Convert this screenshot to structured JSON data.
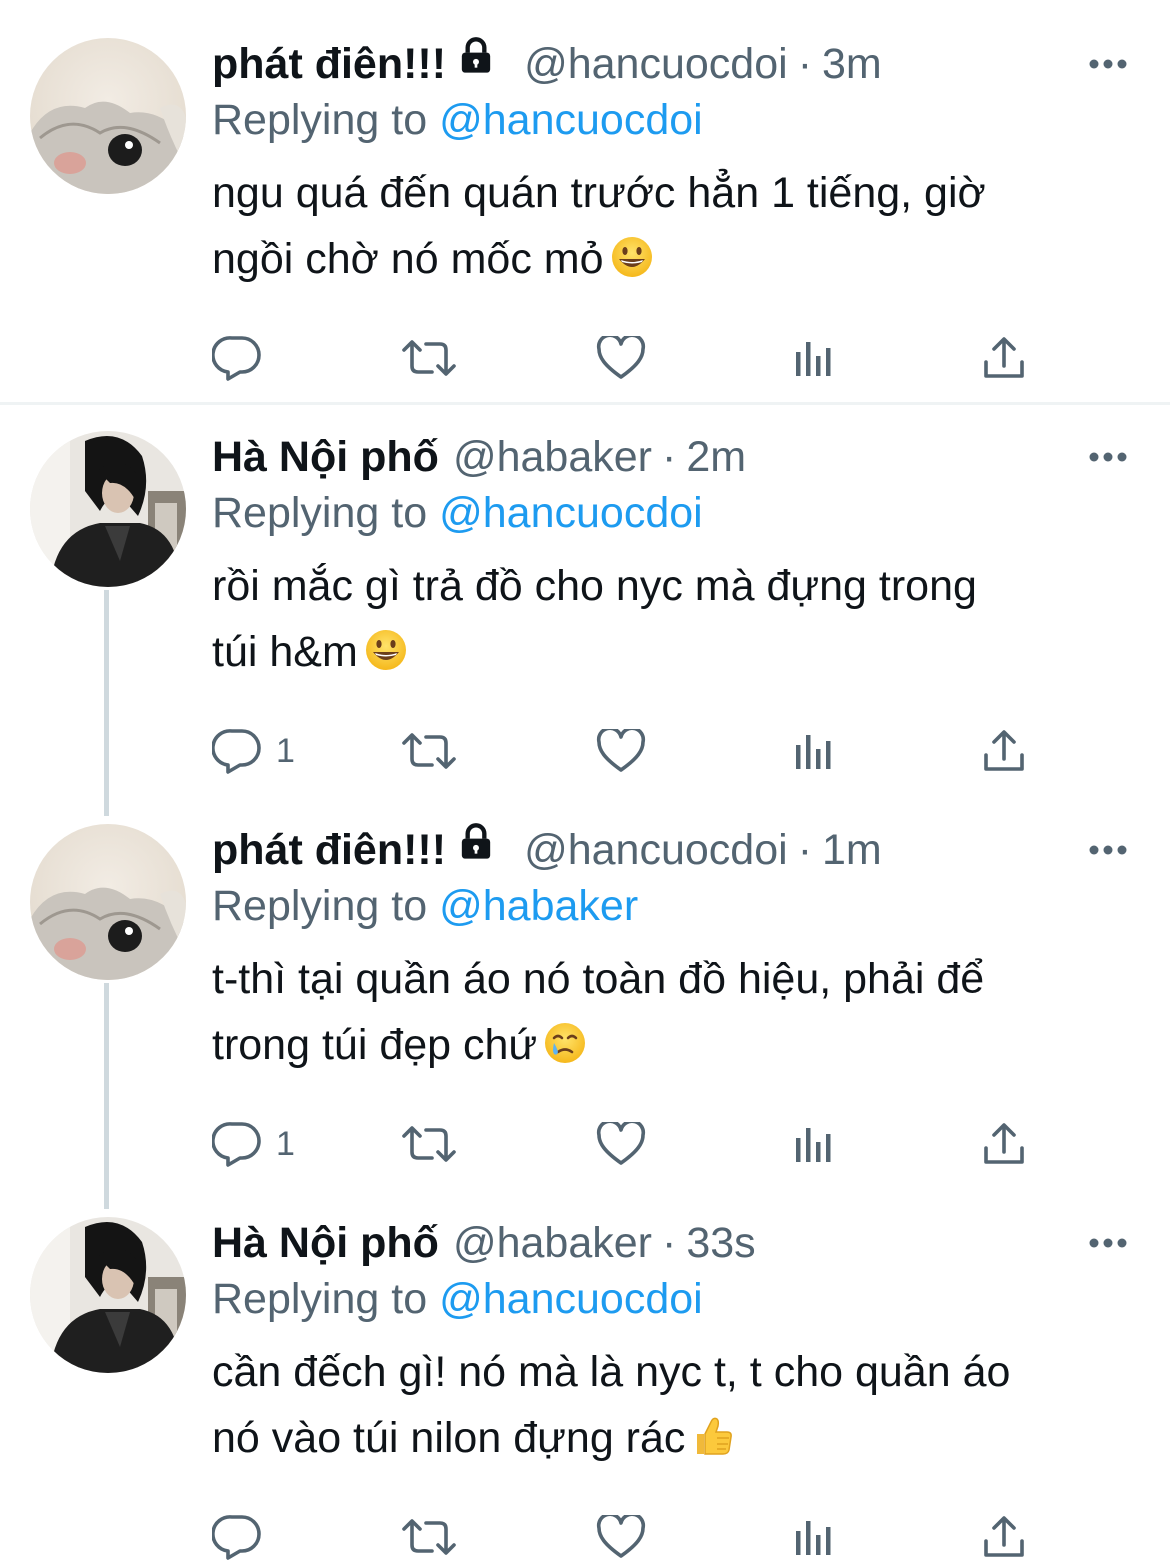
{
  "tweets": [
    {
      "name": "phát điên!!!",
      "locked": true,
      "handle": "@hancuocdoi",
      "time": "3m",
      "reply_prefix": "Replying to",
      "reply_to": "@hancuocdoi",
      "line1": "ngu quá đến quán trước hẳn 1 tiếng, giờ",
      "line2": "ngồi chờ nó mốc mỏ",
      "emoji": "grinning-face-emoji",
      "reply_count": "",
      "avatar": "cat-avatar"
    },
    {
      "name": "Hà Nội phố",
      "locked": false,
      "handle": "@habaker",
      "time": "2m",
      "reply_prefix": "Replying to",
      "reply_to": "@hancuocdoi",
      "line1": "rồi mắc gì trả đồ cho nyc mà đựng trong",
      "line2": "túi h&m",
      "emoji": "grinning-face-emoji",
      "reply_count": "1",
      "avatar": "person-avatar"
    },
    {
      "name": "phát điên!!!",
      "locked": true,
      "handle": "@hancuocdoi",
      "time": "1m",
      "reply_prefix": "Replying to",
      "reply_to": "@habaker",
      "line1": "t-thì tại quần áo nó toàn đồ hiệu, phải để",
      "line2": "trong túi đẹp chứ",
      "emoji": "crying-face-emoji",
      "reply_count": "1",
      "avatar": "cat-avatar"
    },
    {
      "name": "Hà Nội phố",
      "locked": false,
      "handle": "@habaker",
      "time": "33s",
      "reply_prefix": "Replying to",
      "reply_to": "@hancuocdoi",
      "line1": "cần đếch gì! nó mà là nyc t, t cho quần áo",
      "line2": "nó vào túi nilon đựng rác",
      "emoji": "thumbs-up-emoji",
      "reply_count": "",
      "avatar": "person-avatar"
    }
  ],
  "colors": {
    "text": "#0f1419",
    "secondary": "#536471",
    "link": "#1d9bf0",
    "divider": "#eff3f4",
    "thread_line": "#cfd9de"
  }
}
